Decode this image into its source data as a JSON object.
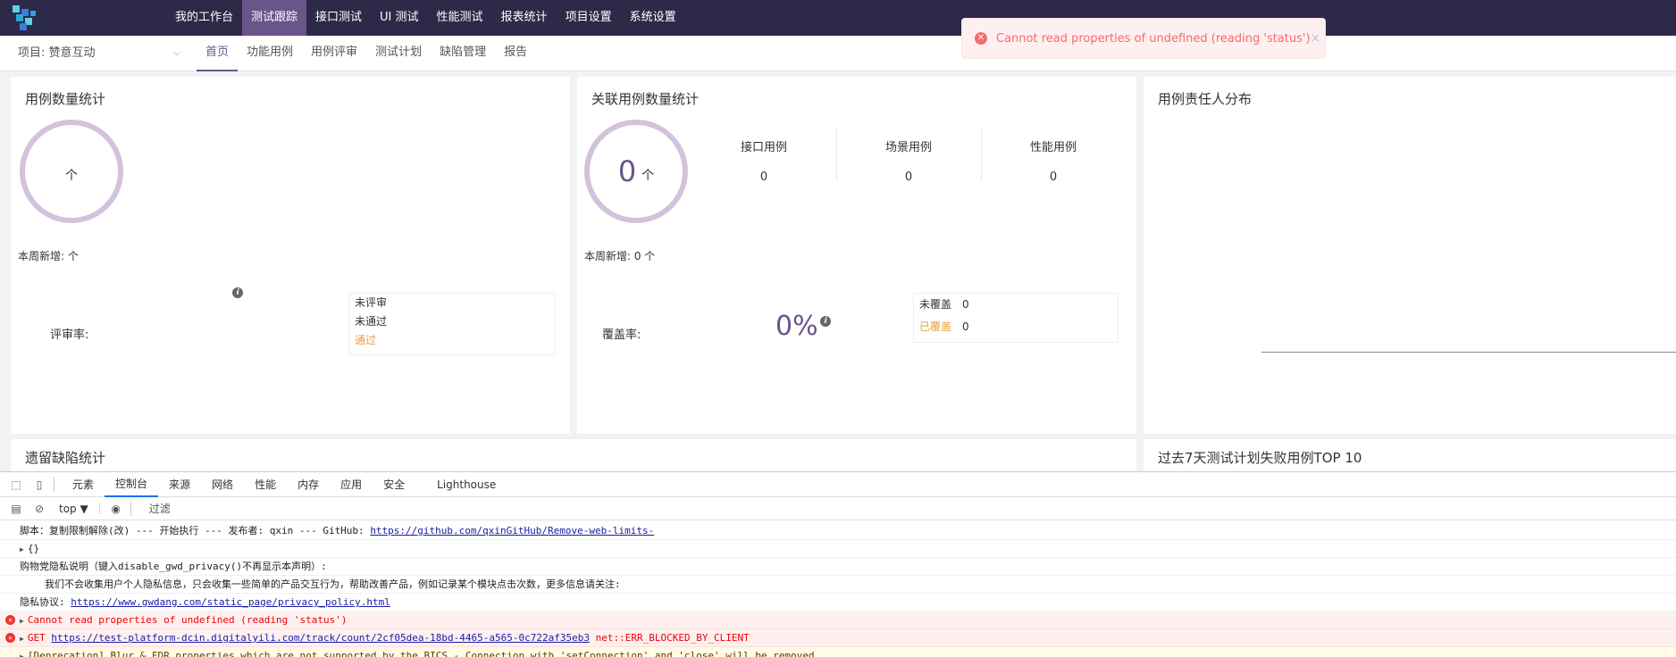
{
  "topnav": {
    "items": [
      {
        "label": "我的工作台",
        "active": false
      },
      {
        "label": "测试跟踪",
        "active": true
      },
      {
        "label": "接口测试",
        "active": false
      },
      {
        "label": "UI 测试",
        "active": false
      },
      {
        "label": "性能测试",
        "active": false
      },
      {
        "label": "报表统计",
        "active": false
      },
      {
        "label": "项目设置",
        "active": false
      },
      {
        "label": "系统设置",
        "active": false
      }
    ]
  },
  "subheader": {
    "project": "项目: 赞意互动",
    "tabs": [
      {
        "label": "首页",
        "active": true
      },
      {
        "label": "功能用例",
        "active": false
      },
      {
        "label": "用例评审",
        "active": false
      },
      {
        "label": "测试计划",
        "active": false
      },
      {
        "label": "缺陷管理",
        "active": false
      },
      {
        "label": "报告",
        "active": false
      }
    ]
  },
  "toast": {
    "message": "Cannot read properties of undefined (reading 'status')",
    "close": "×"
  },
  "case_count": {
    "title": "用例数量统计",
    "ring_unit": "个",
    "weekly": "本周新增: 个",
    "review_rate_label": "评审率:",
    "statuses": [
      "未评审",
      "未通过",
      "通过"
    ]
  },
  "related_count": {
    "title": "关联用例数量统计",
    "ring_value": "0",
    "ring_unit": "个",
    "weekly": "本周新增: 0 个",
    "columns": [
      {
        "label": "接口用例",
        "value": "0"
      },
      {
        "label": "场景用例",
        "value": "0"
      },
      {
        "label": "性能用例",
        "value": "0"
      }
    ],
    "coverage_label": "覆盖率:",
    "coverage_value": "0%",
    "coverage_rows": [
      {
        "label": "未覆盖",
        "value": "0"
      },
      {
        "label": "已覆盖",
        "value": "0"
      }
    ]
  },
  "owner_dist": {
    "title": "用例责任人分布"
  },
  "legacy_defects": {
    "title": "遗留缺陷统计"
  },
  "fail_top10": {
    "title": "过去7天测试计划失败用例TOP 10"
  },
  "devtools": {
    "tabs": [
      {
        "label": "元素",
        "active": false
      },
      {
        "label": "控制台",
        "active": true
      },
      {
        "label": "来源",
        "active": false
      },
      {
        "label": "网络",
        "active": false
      },
      {
        "label": "性能",
        "active": false
      },
      {
        "label": "内存",
        "active": false
      },
      {
        "label": "应用",
        "active": false
      },
      {
        "label": "安全",
        "active": false
      },
      {
        "label": "Lighthouse",
        "active": false
      }
    ],
    "context": "top ▼",
    "filter_placeholder": "过滤",
    "logs": {
      "l1_text": "脚本：复制限制解除(改) --- 开始执行 --- 发布者: qxin --- GitHub: ",
      "l1_link": "https://github.com/qxinGitHub/Remove-web-limits-",
      "l2": "{}",
      "l3": "购物党隐私说明（键入disable_gwd_privacy()不再显示本声明）:",
      "l4": "我们不会收集用户个人隐私信息，只会收集一些简单的产品交互行为，帮助改善产品，例如记录某个模块点击次数，更多信息请关注:",
      "l5_text": "隐私协议: ",
      "l5_link": "https://www.gwdang.com/static_page/privacy_policy.html",
      "l6": "Cannot read properties of undefined (reading 'status')",
      "l7_prefix": "GET ",
      "l7_link": "https://test-platform-dcin.digitalyili.com/track/count/2cf05dea-18bd-4465-a565-0c722af35eb3",
      "l7_suffix": " net::ERR_BLOCKED_BY_CLIENT",
      "l8": "[Deprecation] Blur & FDR properties which are not supported by the BICS - Connection with 'setConnection' and 'close' will be removed"
    }
  }
}
